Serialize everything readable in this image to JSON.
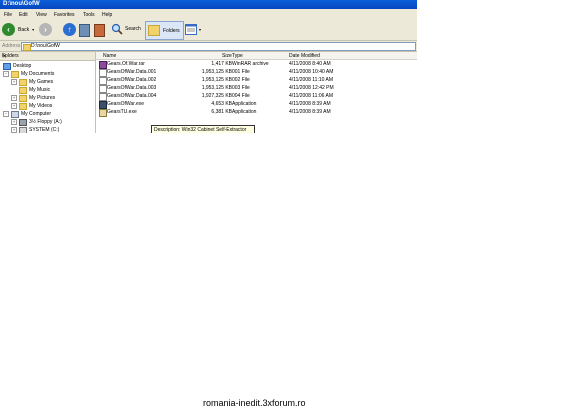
{
  "window": {
    "title": "D:\\nou\\GofW"
  },
  "menu": [
    "File",
    "Edit",
    "View",
    "Favorites",
    "Tools",
    "Help"
  ],
  "toolbar": {
    "back": "Back",
    "search": "Search",
    "folders": "Folders"
  },
  "address": {
    "label": "Address",
    "value": "D:\\nou\\GofW"
  },
  "folders_pane": {
    "title": "Folders",
    "close": "✕",
    "items": [
      "Desktop",
      "My Documents",
      "My Games",
      "My Music",
      "My Pictures",
      "My Videos",
      "My Computer",
      "3½ Floppy (A:)",
      "SYSTEM (C:)"
    ]
  },
  "columns": [
    "Name",
    "Size",
    "Type",
    "Date Modified"
  ],
  "files": [
    {
      "name": "Gears.Of.War.rar",
      "size": "1,417 KB",
      "type": "WinRAR archive",
      "date": "4/11/2008 8:40 AM"
    },
    {
      "name": "GearsOfWar.Data.001",
      "size": "1,953,125 KB",
      "type": "001 File",
      "date": "4/11/2008 10:40 AM"
    },
    {
      "name": "GearsOfWar.Data.002",
      "size": "1,953,125 KB",
      "type": "002 File",
      "date": "4/11/2008 11:10 AM"
    },
    {
      "name": "GearsOfWar.Data.003",
      "size": "1,953,125 KB",
      "type": "003 File",
      "date": "4/11/2008 12:42 PM"
    },
    {
      "name": "GearsOfWar.Data.004",
      "size": "1,927,325 KB",
      "type": "004 File",
      "date": "4/11/2008 11:06 AM"
    },
    {
      "name": "GearsOfWar.exe",
      "size": "4,653 KB",
      "type": "Application",
      "date": "4/11/2008 8:39 AM"
    },
    {
      "name": "GearsTU.exe",
      "size": "6,381 KB",
      "type": "Application",
      "date": "4/11/2008 8:39 AM"
    }
  ],
  "tooltip": "Description: Win32 Cabinet Self-Extractor",
  "footer": "romania-inedit.3xforum.ro"
}
